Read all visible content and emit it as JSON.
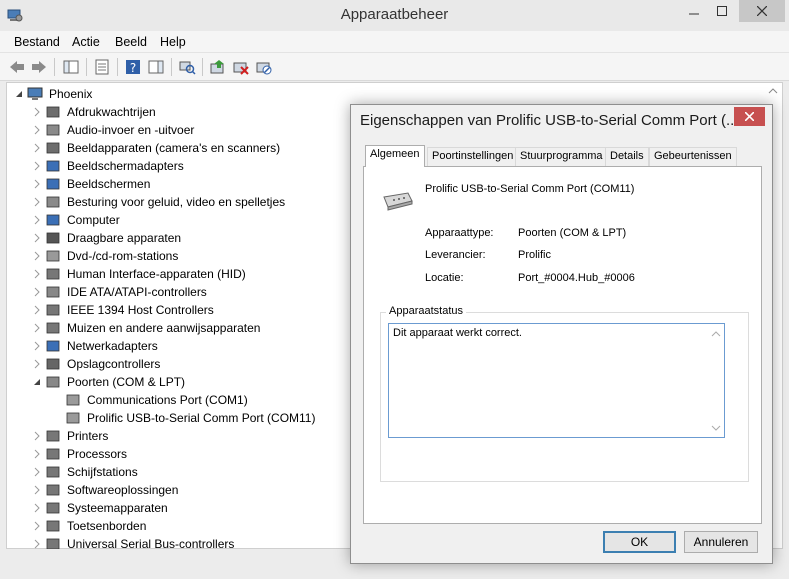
{
  "window": {
    "title": "Apparaatbeheer"
  },
  "menu": [
    "Bestand",
    "Actie",
    "Beeld",
    "Help"
  ],
  "tree": {
    "root": "Phoenix",
    "categories": [
      "Afdrukwachtrijen",
      "Audio-invoer en -uitvoer",
      "Beeldapparaten (camera's en scanners)",
      "Beeldschermadapters",
      "Beeldschermen",
      "Besturing voor geluid, video en spelletjes",
      "Computer",
      "Draagbare apparaten",
      "Dvd-/cd-rom-stations",
      "Human Interface-apparaten (HID)",
      "IDE ATA/ATAPI-controllers",
      "IEEE 1394 Host Controllers",
      "Muizen en andere aanwijsapparaten",
      "Netwerkadapters",
      "Opslagcontrollers",
      "Poorten (COM & LPT)"
    ],
    "ports_children": [
      "Communications Port (COM1)",
      "Prolific USB-to-Serial Comm Port (COM11)"
    ],
    "categories_after": [
      "Printers",
      "Processors",
      "Schijfstations",
      "Softwareoplossingen",
      "Systeemapparaten",
      "Toetsenborden",
      "Universal Serial Bus-controllers"
    ]
  },
  "dialog": {
    "title": "Eigenschappen van Prolific USB-to-Serial Comm Port (...",
    "tabs": [
      "Algemeen",
      "Poortinstellingen",
      "Stuurprogramma",
      "Details",
      "Gebeurtenissen"
    ],
    "device_name": "Prolific USB-to-Serial Comm Port (COM11)",
    "properties": [
      {
        "key": "Apparaattype:",
        "value": "Poorten (COM & LPT)"
      },
      {
        "key": "Leverancier:",
        "value": "Prolific"
      },
      {
        "key": "Locatie:",
        "value": "Port_#0004.Hub_#0006"
      }
    ],
    "status_group": "Apparaatstatus",
    "status_text": "Dit apparaat werkt correct.",
    "ok": "OK",
    "cancel": "Annuleren"
  },
  "colors": {
    "dialog_close": "#c75050",
    "default_button_border": "#3c7fb1",
    "status_border": "#6b9bd1"
  }
}
